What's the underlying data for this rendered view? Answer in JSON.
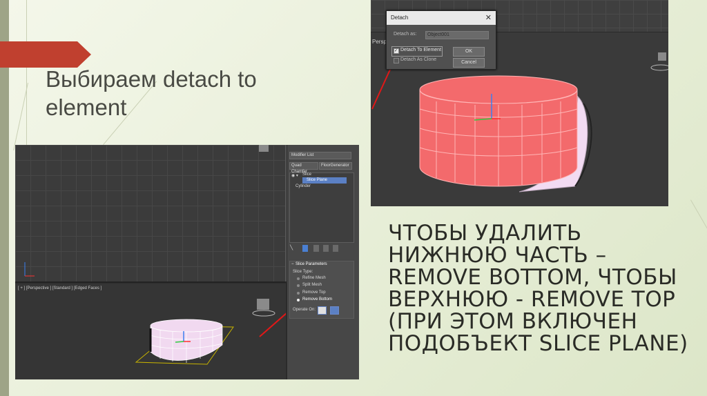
{
  "slide": {
    "title": "Выбираем  detach to element",
    "caption": "ЧТОБЫ УДАЛИТЬ НИЖНЮЮ ЧАСТЬ – REMOVE BOTTOM, ЧТОБЫ ВЕРХНЮЮ - REMOVE TOP (ПРИ ЭТОМ ВКЛЮЧЕН ПОДОБЪЕКТ SLICE PLANE)",
    "colors": {
      "accent": "#c0392b",
      "ribbon": "#c0402f",
      "cylinder": "#f36a6c",
      "slice": "#f2dbf2"
    }
  },
  "detach_dialog": {
    "title": "Detach",
    "close_icon": "close-icon",
    "detach_as_label": "Detach as:",
    "detach_as_value": "Object001",
    "detach_to_element_label": "Detach To Element",
    "detach_to_element_checked": true,
    "detach_as_clone_label": "Detach As Clone",
    "detach_as_clone_checked": false,
    "ok_label": "OK",
    "cancel_label": "Cancel"
  },
  "viewport_top": {
    "label": "Perspe"
  },
  "viewport_bottom": {
    "label": "[ + ] [Perspective ] [Standard ] [Edged Faces ]"
  },
  "command_panel": {
    "modifier_list": "Modifier List",
    "buttons": [
      "Quad Chamfer",
      "FloorGenerator"
    ],
    "stack": [
      {
        "label": "Slice"
      },
      {
        "label": "Slice Plane",
        "selected": true
      },
      {
        "label": "Cylinder"
      }
    ],
    "section_title": "Slice Parameters",
    "slice_type_label": "Slice Type:",
    "slice_types": [
      {
        "label": "Refine Mesh",
        "selected": false
      },
      {
        "label": "Split Mesh",
        "selected": false
      },
      {
        "label": "Remove Top",
        "selected": false
      },
      {
        "label": "Remove Bottom",
        "selected": true
      }
    ],
    "operate_on_label": "Operate On:"
  }
}
